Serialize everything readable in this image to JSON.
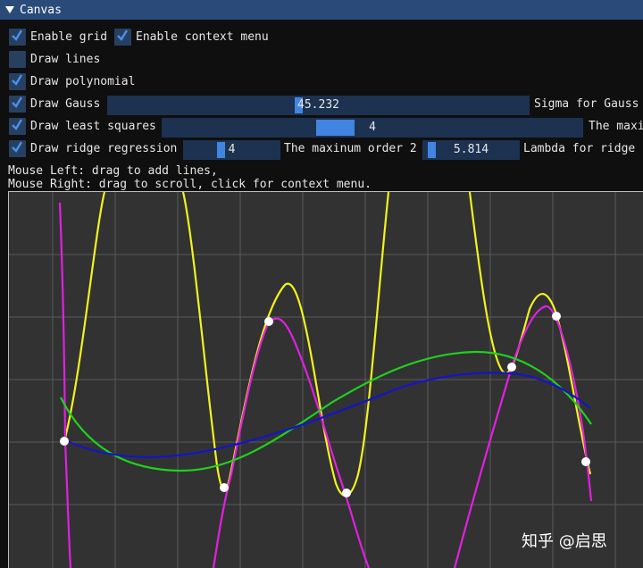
{
  "window": {
    "title": "Canvas"
  },
  "controls": {
    "enable_grid": {
      "label": "Enable grid",
      "checked": true
    },
    "enable_context_menu": {
      "label": "Enable context menu",
      "checked": true
    },
    "draw_lines": {
      "label": "Draw lines",
      "checked": false
    },
    "draw_polynomial": {
      "label": "Draw polynomial",
      "checked": true
    },
    "draw_gauss": {
      "label": "Draw Gauss",
      "checked": true,
      "slider_value": "45.232",
      "slider_label": "Sigma for Gauss"
    },
    "draw_least_squares": {
      "label": "Draw least squares",
      "checked": true,
      "slider_value": "4",
      "slider_label": "The maxi"
    },
    "draw_ridge": {
      "label": "Draw ridge regression",
      "checked": true,
      "order_value": "4",
      "order_label": "The maxinum order 2",
      "lambda_value": "5.814",
      "lambda_label": "Lambda for ridge r"
    }
  },
  "help": {
    "line1": "Mouse Left: drag to add lines,",
    "line2": "Mouse Right: drag to scroll, click for context menu."
  },
  "watermark": "知乎 @启思",
  "colors": {
    "title_bar": "#2a4a7a",
    "slider_grab": "#4285e0",
    "polynomial_curve": "#f2f21e",
    "gauss_curve": "#e020e0",
    "least_squares_curve": "#1ed21e",
    "ridge_curve": "#1414c8",
    "points": "#ffffff"
  }
}
